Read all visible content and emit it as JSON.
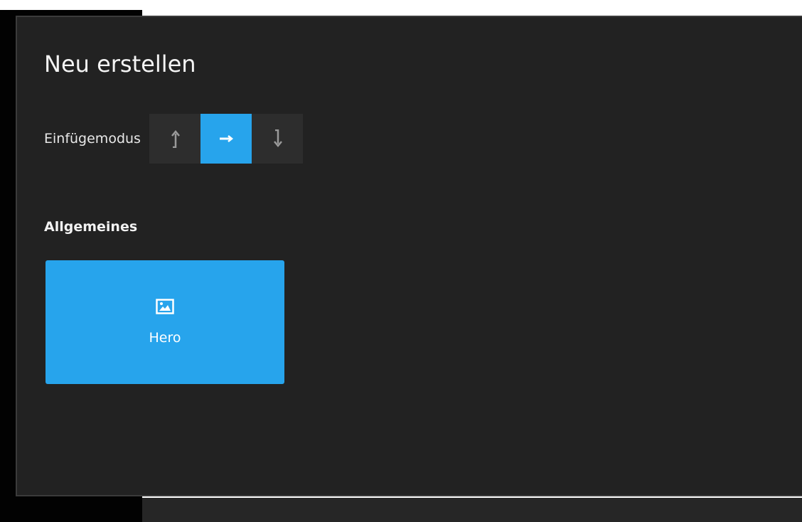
{
  "dialog": {
    "title": "Neu erstellen"
  },
  "insert_mode": {
    "label": "Einfügemodus",
    "options": [
      {
        "name": "insert-before",
        "icon": "arrow-up-icon",
        "selected": false
      },
      {
        "name": "replace",
        "icon": "arrow-right-icon",
        "selected": true
      },
      {
        "name": "insert-after",
        "icon": "arrow-down-icon",
        "selected": false
      }
    ]
  },
  "sections": [
    {
      "heading": "Allgemeines",
      "items": [
        {
          "label": "Hero",
          "icon": "image-icon"
        }
      ]
    }
  ],
  "colors": {
    "accent": "#27a4ec",
    "dialog_background": "#222222",
    "mode_group_background": "#2d2d2d"
  }
}
